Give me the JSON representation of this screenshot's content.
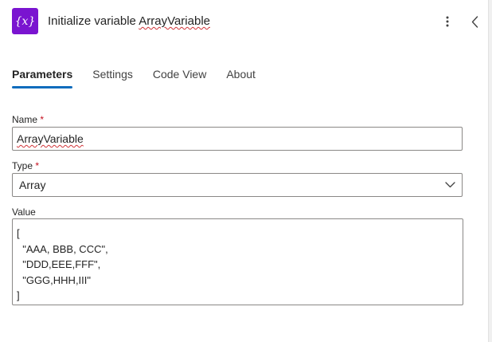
{
  "header": {
    "icon_glyph": "{x}",
    "icon_name": "variable-icon",
    "title_prefix": "Initialize variable ",
    "title_variable": "ArrayVariable",
    "accent_color": "#7a14d0"
  },
  "tabs": [
    {
      "label": "Parameters",
      "active": true
    },
    {
      "label": "Settings",
      "active": false
    },
    {
      "label": "Code View",
      "active": false
    },
    {
      "label": "About",
      "active": false
    }
  ],
  "fields": {
    "name": {
      "label": "Name",
      "required_mark": "*",
      "value": "ArrayVariable"
    },
    "type": {
      "label": "Type",
      "required_mark": "*",
      "value": "Array"
    },
    "value": {
      "label": "Value",
      "lines": [
        "[",
        "  \"AAA, BBB, CCC\",",
        "  \"DDD,EEE,FFF\",",
        "  \"GGG,HHH,III\"",
        "]"
      ]
    }
  },
  "colors": {
    "tab_indicator": "#0f6cbd",
    "required": "#c50f1f",
    "spellcheck": "#d13438"
  }
}
